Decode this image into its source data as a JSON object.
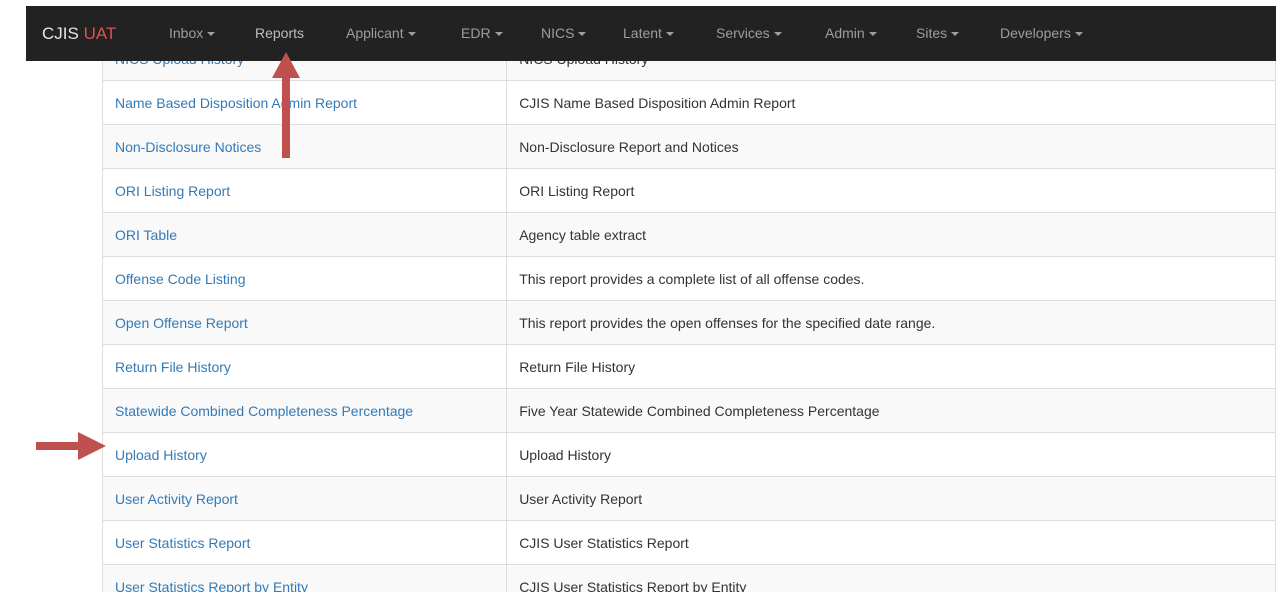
{
  "navbar": {
    "brand_main": "CJIS",
    "brand_accent": "UAT",
    "items": [
      {
        "label": "Inbox",
        "dropdown": true
      },
      {
        "label": "Reports",
        "dropdown": false
      },
      {
        "label": "Applicant",
        "dropdown": true
      },
      {
        "label": "EDR",
        "dropdown": true
      },
      {
        "label": "NICS",
        "dropdown": true
      },
      {
        "label": "Latent",
        "dropdown": true
      },
      {
        "label": "Services",
        "dropdown": true
      },
      {
        "label": "Admin",
        "dropdown": true
      },
      {
        "label": "Sites",
        "dropdown": true
      },
      {
        "label": "Developers",
        "dropdown": true
      }
    ]
  },
  "reports_table": {
    "rows": [
      {
        "name": "NICS Upload History",
        "description": "NICS Upload History"
      },
      {
        "name": "Name Based Disposition Admin Report",
        "description": "CJIS Name Based Disposition Admin Report"
      },
      {
        "name": "Non-Disclosure Notices",
        "description": "Non-Disclosure Report and Notices"
      },
      {
        "name": "ORI Listing Report",
        "description": "ORI Listing Report"
      },
      {
        "name": "ORI Table",
        "description": "Agency table extract"
      },
      {
        "name": "Offense Code Listing",
        "description": "This report provides a complete list of all offense codes."
      },
      {
        "name": "Open Offense Report",
        "description": "This report provides the open offenses for the specified date range."
      },
      {
        "name": "Return File History",
        "description": "Return File History"
      },
      {
        "name": "Statewide Combined Completeness Percentage",
        "description": "Five Year Statewide Combined Completeness Percentage"
      },
      {
        "name": "Upload History",
        "description": "Upload History"
      },
      {
        "name": "User Activity Report",
        "description": "User Activity Report"
      },
      {
        "name": "User Statistics Report",
        "description": "CJIS User Statistics Report"
      },
      {
        "name": "User Statistics Report by Entity",
        "description": "CJIS User Statistics Report by Entity"
      }
    ]
  },
  "colors": {
    "navbar_bg": "#222222",
    "brand_accent": "#d9534f",
    "link": "#337ab7",
    "annotation_arrow": "#c0504d"
  }
}
